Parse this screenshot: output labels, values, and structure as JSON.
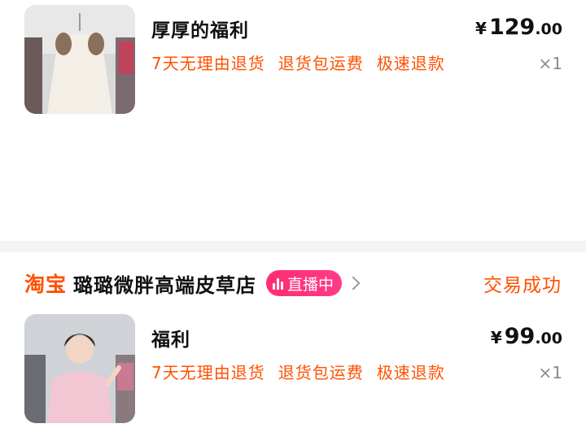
{
  "orders": [
    {
      "title": "厚厚的福利",
      "tags": [
        "7天无理由退货",
        "退货包运费",
        "极速退款"
      ],
      "price": {
        "currency": "¥",
        "integer": "129",
        "decimal": ".00"
      },
      "quantity": "×1"
    },
    {
      "title": "福利",
      "tags": [
        "7天无理由退货",
        "退货包运费",
        "极速退款"
      ],
      "price": {
        "currency": "¥",
        "integer": "99",
        "decimal": ".00"
      },
      "quantity": "×1"
    }
  ],
  "shop": {
    "brand": "淘宝",
    "name": "璐璐微胖高端皮草店",
    "live_label": "直播中",
    "status": "交易成功"
  },
  "colors": {
    "accent": "#ff5000",
    "live_badge": "#ff2d6e",
    "divider": "#f2f3f5"
  }
}
